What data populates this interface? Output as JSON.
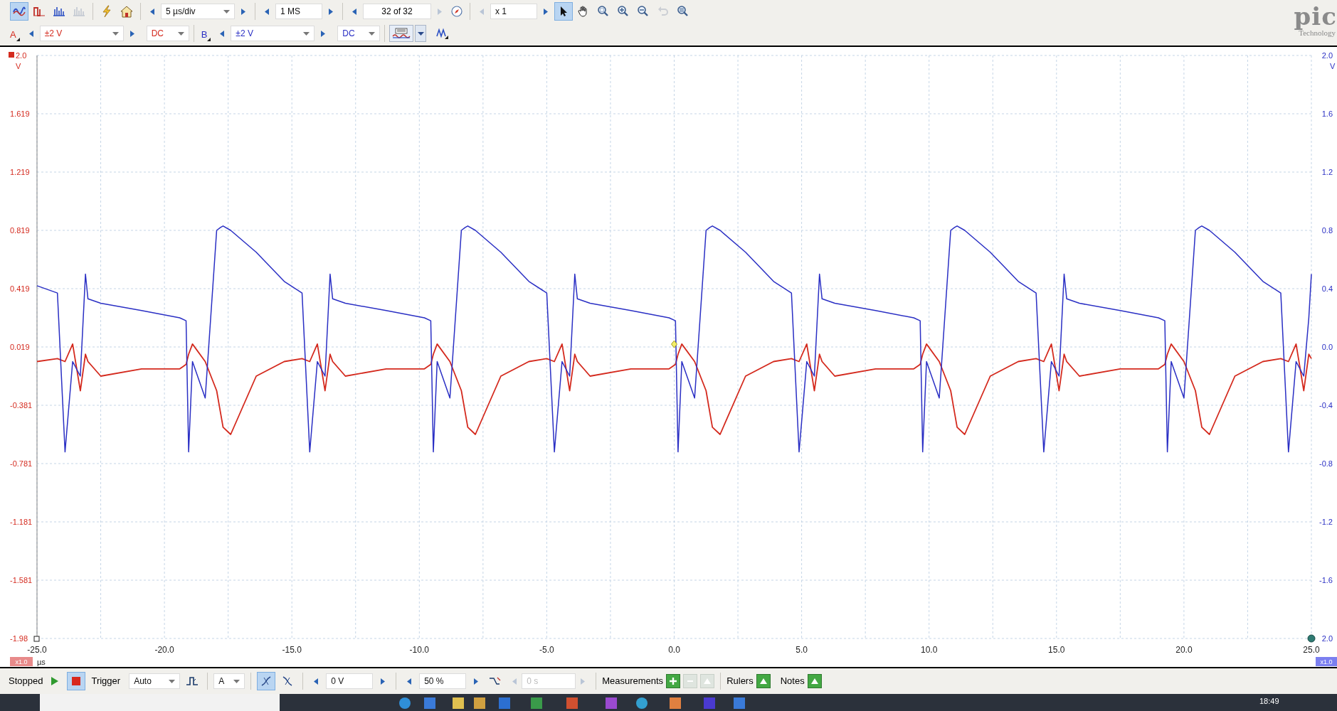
{
  "toolbar": {
    "mode_tools": [
      {
        "kind": "scope",
        "selected": true,
        "disabled": false
      },
      {
        "kind": "persistence",
        "selected": false,
        "disabled": false
      },
      {
        "kind": "spectrum",
        "selected": false,
        "disabled": false
      },
      {
        "kind": "spectrum",
        "selected": false,
        "disabled": true
      }
    ],
    "timebase": "5 µs/div",
    "samples": "1 MS",
    "buffer": "32 of 32",
    "zoom_factor": "x 1",
    "view_tools": [
      {
        "kind": "pointer",
        "selected": true,
        "disabled": false
      },
      {
        "kind": "hand",
        "selected": false,
        "disabled": false
      },
      {
        "kind": "zoom_area",
        "selected": false,
        "disabled": false
      },
      {
        "kind": "zoom_in",
        "selected": false,
        "disabled": false
      },
      {
        "kind": "zoom_out",
        "selected": false,
        "disabled": false
      },
      {
        "kind": "undo",
        "selected": false,
        "disabled": true
      },
      {
        "kind": "zoom_fit",
        "selected": false,
        "disabled": false
      }
    ],
    "channels": [
      {
        "name": "A",
        "range": "±2 V",
        "coupling": "DC",
        "color": "#d42a1e"
      },
      {
        "name": "B",
        "range": "±2 V",
        "coupling": "DC",
        "color": "#2a2fc4"
      }
    ],
    "logo": {
      "name": "pic",
      "tagline": "Technology"
    }
  },
  "scope_view": {
    "left_axis": {
      "labels": [
        "2.0",
        "1.619",
        "1.219",
        "0.819",
        "0.419",
        "0.019",
        "-0.381",
        "-0.781",
        "-1.181",
        "-1.581",
        "-1.98"
      ],
      "unit": "V"
    },
    "right_axis_unit": "V",
    "x_unit": "µs",
    "scale_badges": [
      "x1.0",
      "x1.0"
    ],
    "chart_data": {
      "type": "line",
      "grid": true,
      "xlim": [
        -25,
        25
      ],
      "ylim": [
        -2,
        2
      ],
      "xticks": [
        {
          "value": -25,
          "label": "-25.0"
        },
        {
          "value": -20,
          "label": "-20.0"
        },
        {
          "value": -15,
          "label": "-15.0"
        },
        {
          "value": -10,
          "label": "-10.0"
        },
        {
          "value": -5,
          "label": "-5.0"
        },
        {
          "value": 0,
          "label": "0.0"
        },
        {
          "value": 5,
          "label": "5.0"
        },
        {
          "value": 10,
          "label": "10.0"
        },
        {
          "value": 15,
          "label": "15.0"
        },
        {
          "value": 20,
          "label": "20.0"
        },
        {
          "value": 25,
          "label": "25.0"
        }
      ],
      "yticks": [
        {
          "value": 2,
          "label": "2.0"
        },
        {
          "value": 1.6,
          "label": "1.6"
        },
        {
          "value": 1.2,
          "label": "1.2"
        },
        {
          "value": 0.8,
          "label": "0.8"
        },
        {
          "value": 0.4,
          "label": "0.4"
        },
        {
          "value": 0,
          "label": "0.0"
        },
        {
          "value": -0.4,
          "label": "-0.4"
        },
        {
          "value": -0.8,
          "label": "-0.8"
        },
        {
          "value": -1.2,
          "label": "-1.2"
        },
        {
          "value": -1.6,
          "label": "-1.6"
        },
        {
          "value": -2,
          "label": "2.0"
        }
      ],
      "x": [
        -25,
        -24.2,
        -23.9,
        -23.6,
        -23.3,
        -23.1,
        -23,
        -22.5,
        -20.9,
        -19.4,
        -19.15,
        -19.05,
        -18.9,
        -18.4,
        -17.95,
        -17.8,
        -17.7,
        -17.4,
        -16.4,
        -15.3,
        -14.6,
        -14.3,
        -14,
        -13.7,
        -13.5,
        -13.4,
        -12.9,
        -11.3,
        -9.8,
        -9.55,
        -9.45,
        -9.3,
        -8.8,
        -8.35,
        -8.2,
        -8.1,
        -7.8,
        -6.8,
        -5.7,
        -5,
        -4.7,
        -4.4,
        -4.1,
        -3.9,
        -3.8,
        -3.3,
        -1.7,
        -0.2,
        0.05,
        0.15,
        0.3,
        0.8,
        1.25,
        1.4,
        1.5,
        1.8,
        2.8,
        3.9,
        4.6,
        4.9,
        5.2,
        5.5,
        5.7,
        5.8,
        6.3,
        7.9,
        9.4,
        9.65,
        9.75,
        9.9,
        10.4,
        10.85,
        11,
        11.1,
        11.4,
        12.4,
        13.5,
        14.2,
        14.5,
        14.8,
        15.1,
        15.3,
        15.4,
        15.9,
        17.5,
        19,
        19.25,
        19.35,
        19.5,
        20,
        20.45,
        20.6,
        20.7,
        21,
        22,
        23.1,
        23.8,
        24.1,
        24.4,
        24.7,
        24.9,
        25
      ],
      "series": [
        {
          "color": "#d42a1e",
          "values": [
            -0.1,
            -0.08,
            -0.1,
            0.02,
            -0.3,
            -0.05,
            -0.1,
            -0.2,
            -0.15,
            -0.15,
            -0.12,
            -0.05,
            0.02,
            -0.1,
            -0.3,
            -0.45,
            -0.55,
            -0.6,
            -0.2,
            -0.1,
            -0.08,
            -0.1,
            0.02,
            -0.3,
            -0.05,
            -0.1,
            -0.2,
            -0.15,
            -0.15,
            -0.12,
            -0.05,
            0.02,
            -0.1,
            -0.3,
            -0.45,
            -0.55,
            -0.6,
            -0.2,
            -0.1,
            -0.08,
            -0.1,
            0.02,
            -0.3,
            -0.05,
            -0.1,
            -0.2,
            -0.15,
            -0.15,
            -0.12,
            -0.05,
            0.02,
            -0.1,
            -0.3,
            -0.45,
            -0.55,
            -0.6,
            -0.2,
            -0.1,
            -0.08,
            -0.1,
            0.02,
            -0.3,
            -0.05,
            -0.1,
            -0.2,
            -0.15,
            -0.15,
            -0.12,
            -0.05,
            0.02,
            -0.1,
            -0.3,
            -0.45,
            -0.55,
            -0.6,
            -0.2,
            -0.1,
            -0.08,
            -0.1,
            0.02,
            -0.3,
            -0.05,
            -0.1,
            -0.2,
            -0.15,
            -0.15,
            -0.12,
            -0.05,
            0.02,
            -0.1,
            -0.3,
            -0.45,
            -0.55,
            -0.6,
            -0.2,
            -0.1,
            -0.08,
            -0.1,
            0.02,
            -0.3,
            -0.05,
            -0.08
          ]
        },
        {
          "color": "#2a2fc4",
          "values": [
            0.42,
            0.37,
            -0.72,
            -0.1,
            -0.2,
            0.5,
            0.33,
            0.3,
            0.25,
            0.2,
            0.18,
            -0.72,
            -0.1,
            -0.35,
            0.8,
            0.82,
            0.83,
            0.8,
            0.65,
            0.45,
            0.37,
            -0.72,
            -0.1,
            -0.2,
            0.5,
            0.33,
            0.3,
            0.25,
            0.2,
            0.18,
            -0.72,
            -0.1,
            -0.35,
            0.8,
            0.82,
            0.83,
            0.8,
            0.65,
            0.45,
            0.37,
            -0.72,
            -0.1,
            -0.2,
            0.5,
            0.33,
            0.3,
            0.25,
            0.2,
            0.18,
            -0.72,
            -0.1,
            -0.35,
            0.8,
            0.82,
            0.83,
            0.8,
            0.65,
            0.45,
            0.37,
            -0.72,
            -0.1,
            -0.2,
            0.5,
            0.33,
            0.3,
            0.25,
            0.2,
            0.18,
            -0.72,
            -0.1,
            -0.35,
            0.8,
            0.82,
            0.83,
            0.8,
            0.65,
            0.45,
            0.37,
            -0.72,
            -0.1,
            -0.2,
            0.5,
            0.33,
            0.3,
            0.25,
            0.2,
            0.18,
            -0.72,
            -0.1,
            -0.35,
            0.8,
            0.82,
            0.83,
            0.8,
            0.65,
            0.45,
            0.37,
            -0.72,
            -0.1,
            -0.2,
            0.2,
            0.5
          ]
        }
      ]
    }
  },
  "trigger_bar": {
    "status": "Stopped",
    "running": false,
    "trigger_label": "Trigger",
    "mode": "Auto",
    "source": "A",
    "edges": [
      {
        "kind": "rising",
        "selected": true
      },
      {
        "kind": "falling",
        "selected": false
      }
    ],
    "threshold": "0 V",
    "pre_trigger": "50 %",
    "delay": "0 s",
    "delay_disabled": true,
    "measurements": "Measurements",
    "rulers": "Rulers",
    "notes": "Notes"
  },
  "taskbar": {
    "clock": "18:49"
  }
}
